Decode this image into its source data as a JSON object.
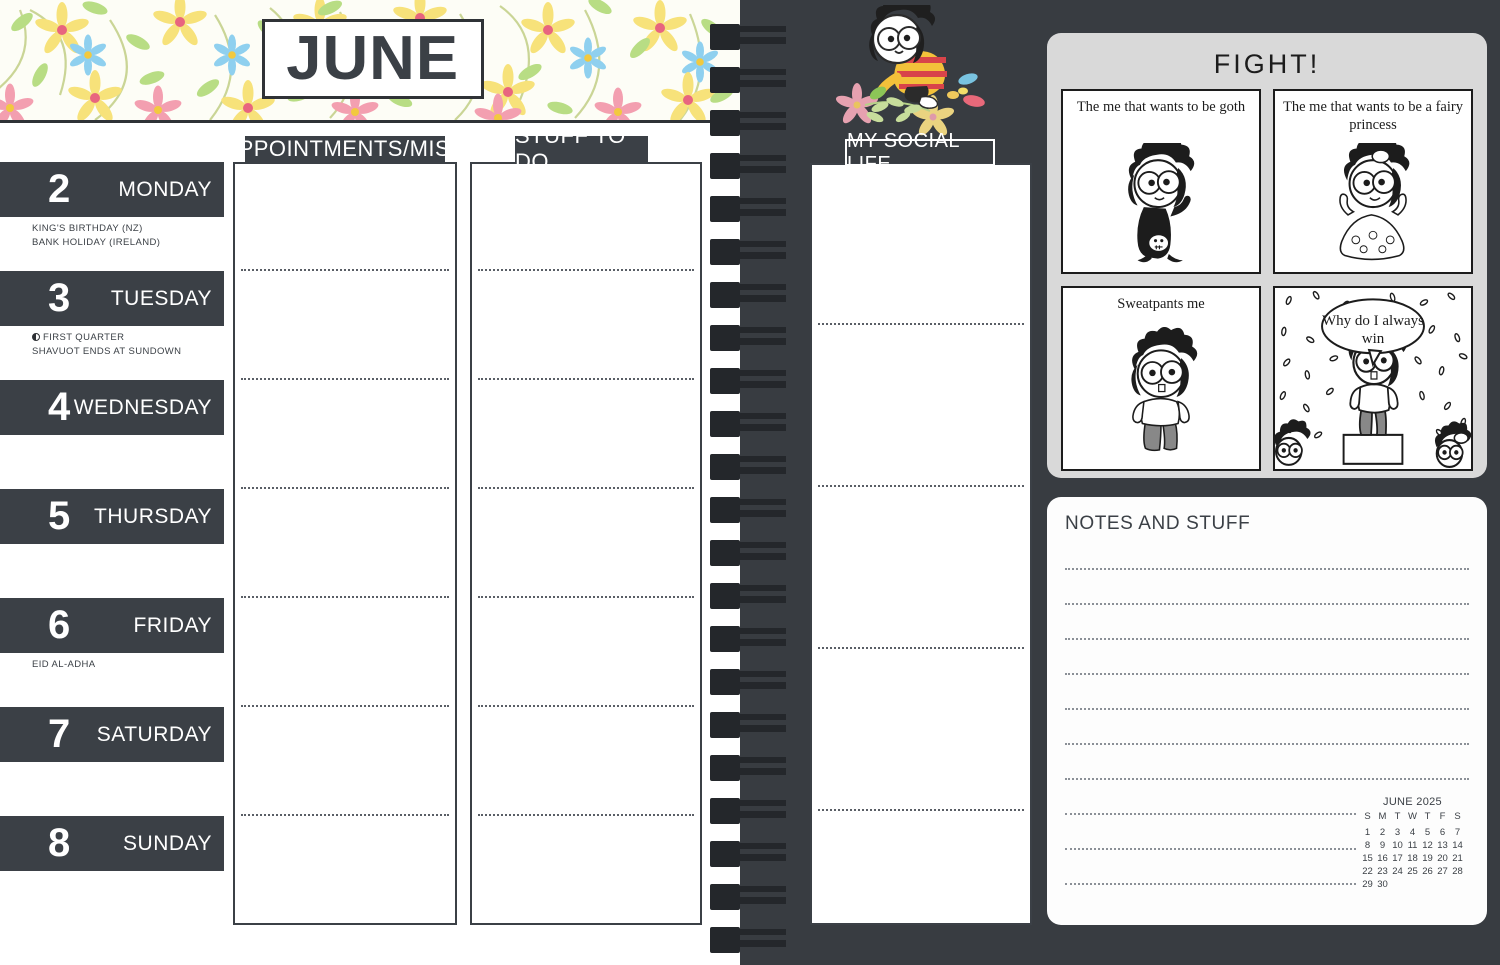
{
  "month": {
    "title": "JUNE"
  },
  "columns": {
    "appointments_label": "APPOINTMENTS/MISC",
    "todo_label": "STUFF TO DO",
    "social_label": "MY SOCIAL LIFE"
  },
  "days": [
    {
      "num": "2",
      "name": "MONDAY",
      "notes": [
        "KING'S BIRTHDAY (NZ)",
        "BANK HOLIDAY (IRELAND)"
      ],
      "moon": false
    },
    {
      "num": "3",
      "name": "TUESDAY",
      "notes": [
        "FIRST QUARTER",
        "SHAVUOT ENDS AT SUNDOWN"
      ],
      "moon": true
    },
    {
      "num": "4",
      "name": "WEDNESDAY",
      "notes": [],
      "moon": false
    },
    {
      "num": "5",
      "name": "THURSDAY",
      "notes": [],
      "moon": false
    },
    {
      "num": "6",
      "name": "FRIDAY",
      "notes": [
        "EID AL-ADHA"
      ],
      "moon": false
    },
    {
      "num": "7",
      "name": "SATURDAY",
      "notes": [],
      "moon": false
    },
    {
      "num": "8",
      "name": "SUNDAY",
      "notes": [],
      "moon": false
    }
  ],
  "comic": {
    "title": "FIGHT!",
    "panels": [
      {
        "caption": "The me that wants to be goth"
      },
      {
        "caption": "The me that wants to be a fairy princess"
      },
      {
        "caption": "Sweatpants me"
      },
      {
        "caption": "",
        "speech": "Why do I always win"
      }
    ]
  },
  "notes": {
    "title": "NOTES AND STUFF"
  },
  "mini_calendar": {
    "title": "JUNE 2025",
    "weekday_headers": [
      "S",
      "M",
      "T",
      "W",
      "T",
      "F",
      "S"
    ],
    "weeks": [
      [
        "",
        "",
        "",
        "",
        "",
        "",
        "1"
      ],
      [
        "",
        "",
        "",
        "",
        "",
        "",
        ""
      ],
      [
        "",
        "",
        "",
        "",
        "",
        "",
        ""
      ],
      [
        "",
        "",
        "",
        "",
        "",
        "",
        ""
      ],
      [
        "",
        "",
        "",
        "",
        "",
        "",
        ""
      ]
    ],
    "rows": [
      [
        "1",
        "2",
        "3",
        "4",
        "5",
        "6",
        "7"
      ],
      [
        "8",
        "9",
        "10",
        "11",
        "12",
        "13",
        "14"
      ],
      [
        "15",
        "16",
        "17",
        "18",
        "19",
        "20",
        "21"
      ],
      [
        "22",
        "23",
        "24",
        "25",
        "26",
        "27",
        "28"
      ],
      [
        "29",
        "30",
        "",
        "",
        "",
        "",
        ""
      ]
    ]
  },
  "colors": {
    "dark": "#3b4046",
    "darker": "#24272b",
    "page_bg": "#383c41",
    "card_gray": "#d9d9d9",
    "paper": "#ffffff",
    "floral_bg": "#fdfdf6"
  }
}
